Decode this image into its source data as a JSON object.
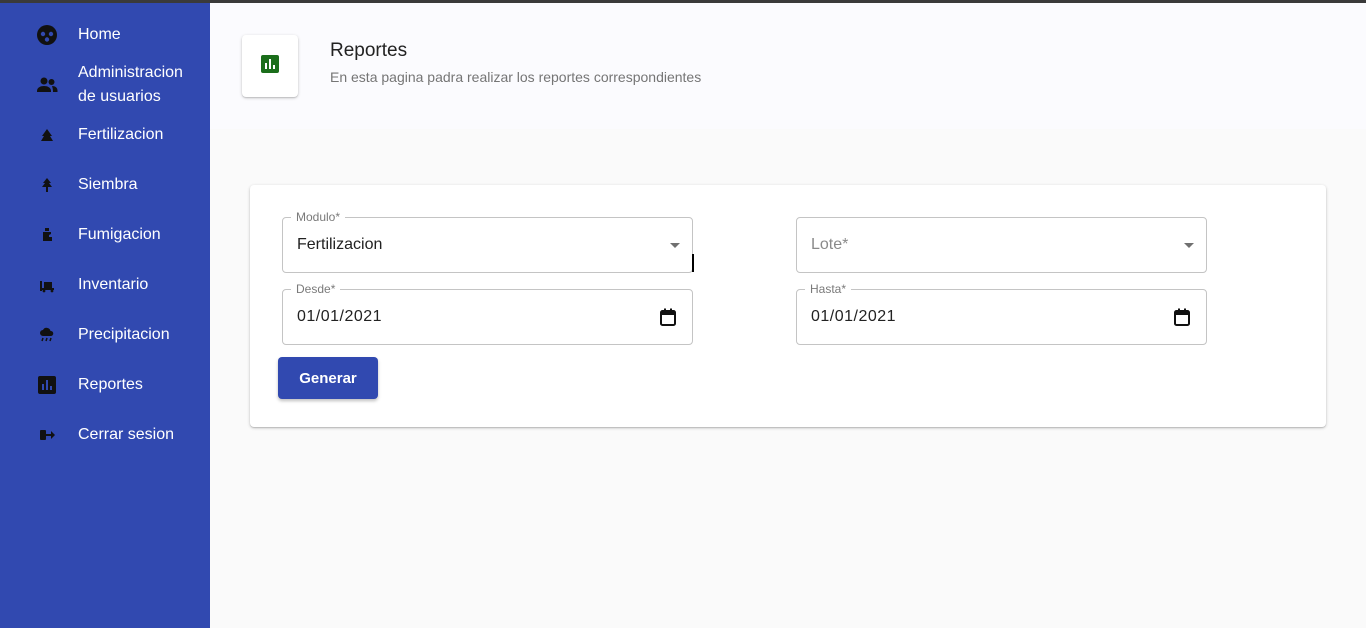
{
  "sidebar": {
    "items": [
      {
        "label": "Home",
        "icon": "home-icon"
      },
      {
        "label": "Administracion de usuarios",
        "icon": "users-icon"
      },
      {
        "label": "Fertilizacion",
        "icon": "fertilizer-icon"
      },
      {
        "label": "Siembra",
        "icon": "tree-icon"
      },
      {
        "label": "Fumigacion",
        "icon": "sprayer-icon"
      },
      {
        "label": "Inventario",
        "icon": "inventory-icon"
      },
      {
        "label": "Precipitacion",
        "icon": "rain-icon"
      },
      {
        "label": "Reportes",
        "icon": "chart-icon"
      },
      {
        "label": "Cerrar sesion",
        "icon": "logout-icon"
      }
    ]
  },
  "header": {
    "title": "Reportes",
    "subtitle": "En esta pagina padra realizar los reportes correspondientes",
    "icon": "chart-icon",
    "icon_color": "#1b6e1b"
  },
  "form": {
    "modulo": {
      "label": "Modulo*",
      "value": "Fertilizacion"
    },
    "lote": {
      "placeholder": "Lote*",
      "value": ""
    },
    "desde": {
      "label": "Desde*",
      "value": "01/01/2021"
    },
    "hasta": {
      "label": "Hasta*",
      "value": "01/01/2021"
    },
    "submit_label": "Generar"
  },
  "colors": {
    "sidebar": "#3149b0",
    "button": "#3149b0",
    "background": "#fafafa"
  }
}
